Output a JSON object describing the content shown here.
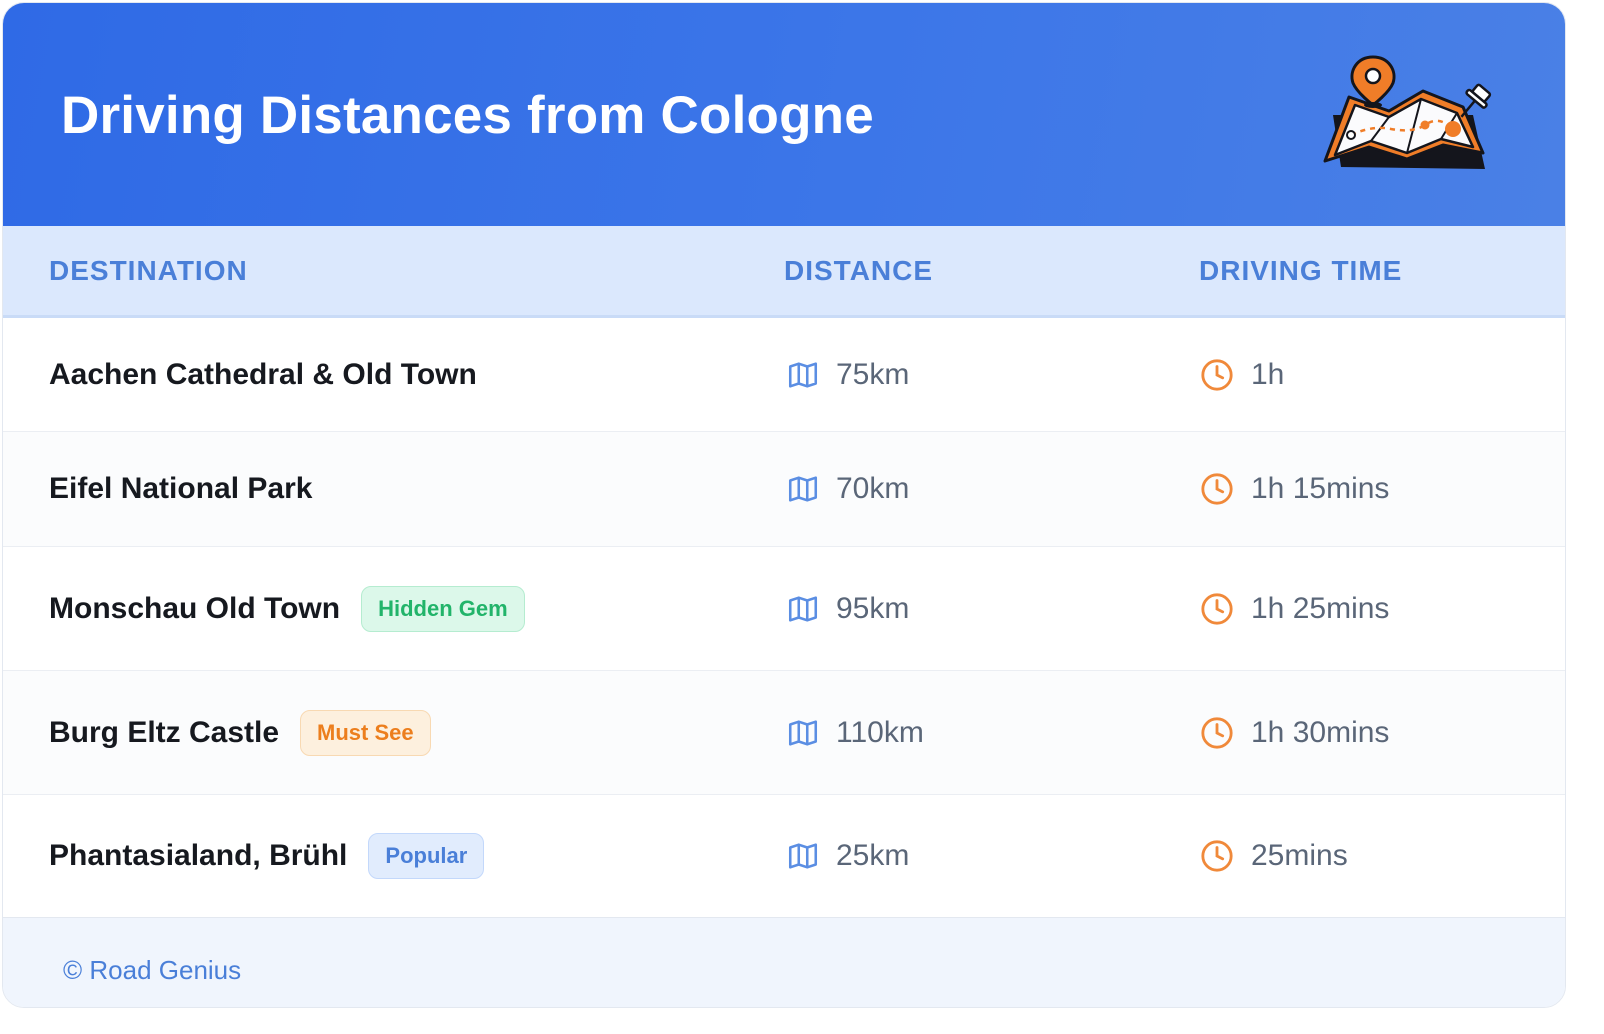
{
  "header": {
    "title": "Driving Distances from Cologne",
    "icon": "map-with-pin-icon"
  },
  "table": {
    "columns": [
      "DESTINATION",
      "DISTANCE",
      "DRIVING TIME"
    ],
    "rows": [
      {
        "destination": "Aachen Cathedral & Old Town",
        "badge": "",
        "distance": "75km",
        "time": "1h"
      },
      {
        "destination": "Eifel National Park",
        "badge": "",
        "distance": "70km",
        "time": "1h 15mins"
      },
      {
        "destination": "Monschau Old Town",
        "badge": "Hidden Gem",
        "badge_color": "#22b46a",
        "distance": "95km",
        "time": "1h 25mins"
      },
      {
        "destination": "Burg Eltz Castle",
        "badge": "Must See",
        "badge_color": "#ec7e1d",
        "distance": "110km",
        "time": "1h 30mins"
      },
      {
        "destination": "Phantasialand, Brühl",
        "badge": "Popular",
        "badge_color": "#4a7fd8",
        "distance": "25km",
        "time": "25mins"
      }
    ],
    "distance_icon": "map-icon",
    "time_icon": "clock-icon"
  },
  "footer": {
    "credit": "© Road Genius"
  },
  "colors": {
    "header_blue": "#2f6ae6",
    "accent_orange": "#f0893a",
    "accent_blue": "#4a7fd8"
  }
}
